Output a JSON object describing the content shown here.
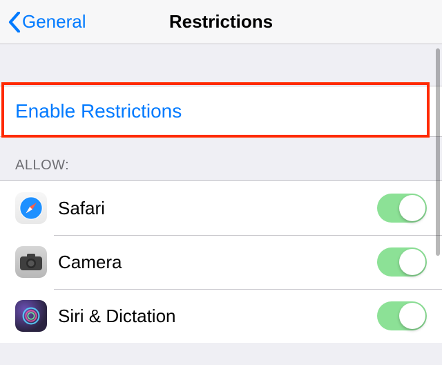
{
  "nav": {
    "back_label": "General",
    "title": "Restrictions"
  },
  "enable": {
    "label": "Enable Restrictions"
  },
  "section": {
    "header": "ALLOW:"
  },
  "rows": [
    {
      "label": "Safari",
      "icon": "safari",
      "on": true
    },
    {
      "label": "Camera",
      "icon": "camera",
      "on": true
    },
    {
      "label": "Siri & Dictation",
      "icon": "siri",
      "on": true
    }
  ],
  "colors": {
    "link": "#007aff",
    "switch_on": "#8ce196",
    "highlight": "#ff2a00"
  }
}
